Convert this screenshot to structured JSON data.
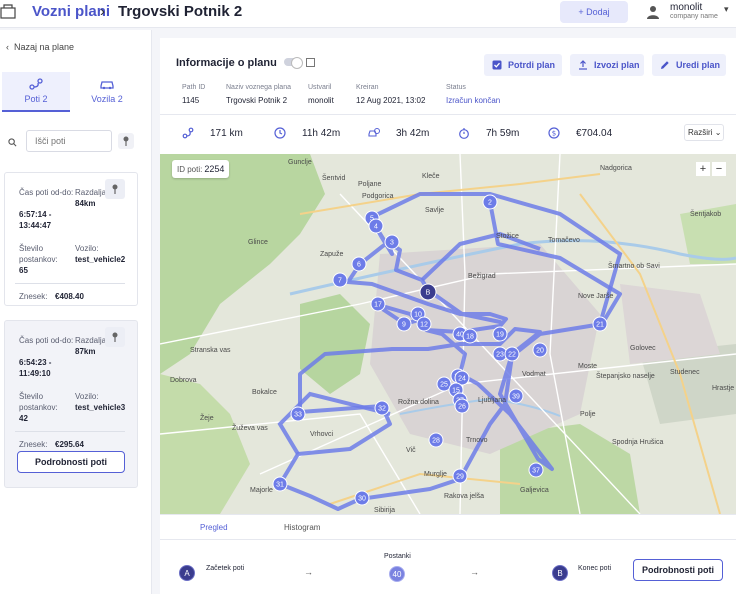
{
  "header": {
    "breadcrumb_root": "Vozni plani",
    "breadcrumb_current": "Trgovski Potnik 2",
    "add_label": "+ Dodaj",
    "user_name": "monolit",
    "company_name": "company name"
  },
  "sidebar": {
    "back_label": "Nazaj na plane",
    "tabs": [
      {
        "label": "Poti 2",
        "icon": "route-icon",
        "active": true
      },
      {
        "label": "Vozila 2",
        "icon": "car-icon",
        "active": false
      }
    ],
    "search_placeholder": "Išči poti",
    "routes": [
      {
        "time_label": "Čas poti od-do:",
        "time_value": "6:57:14 - 13:44:47",
        "distance_label": "Razdalja:",
        "distance_value": "84km",
        "stops_label": "Število postankov:",
        "stops_value": "65",
        "vehicle_label": "Vozilo:",
        "vehicle_value": "test_vehicle2",
        "amount_label": "Znesek:",
        "amount_value": "€408.40"
      },
      {
        "time_label": "Čas poti od-do:",
        "time_value": "6:54:23 - 11:49:10",
        "distance_label": "Razdalja:",
        "distance_value": "87km",
        "stops_label": "Število postankov:",
        "stops_value": "42",
        "vehicle_label": "Vozilo:",
        "vehicle_value": "test_vehicle3",
        "amount_label": "Znesek:",
        "amount_value": "€295.64",
        "details_label": "Podrobnosti poti"
      }
    ]
  },
  "main": {
    "info_title": "Informacije o planu",
    "actions": {
      "confirm": "Potrdi plan",
      "export": "Izvozi plan",
      "edit": "Uredi plan"
    },
    "meta": [
      {
        "label": "Path ID",
        "value": "1145"
      },
      {
        "label": "Naziv voznega plana",
        "value": "Trgovski Potnik 2"
      },
      {
        "label": "Ustvaril",
        "value": "monolit"
      },
      {
        "label": "Kreiran",
        "value": "12 Aug 2021, 13:02"
      },
      {
        "label": "Status",
        "value": "Izračun končan"
      }
    ],
    "stats": {
      "distance": "171 km",
      "total_time": "11h 42m",
      "driving_time": "3h 42m",
      "other_time": "7h 59m",
      "cost": "€704.04",
      "expand_label": "Razširi"
    },
    "map": {
      "id_label": "ID poti:",
      "id_value": "2254",
      "zoom_in": "+",
      "zoom_out": "−",
      "route_color": "#6d7ce8",
      "place_labels": [
        {
          "text": "Gunclje"
        },
        {
          "text": "Kleče"
        },
        {
          "text": "Šentvid"
        },
        {
          "text": "Poljane"
        },
        {
          "text": "Podgorica"
        },
        {
          "text": "Savlje"
        },
        {
          "text": "Stožice"
        },
        {
          "text": "Tomačevo"
        },
        {
          "text": "Nadgorica"
        },
        {
          "text": "Šentjakob"
        },
        {
          "text": "Glince"
        },
        {
          "text": "Zapuže"
        },
        {
          "text": "Šmartno ob Savi"
        },
        {
          "text": "Bežigrad"
        },
        {
          "text": "Nove Jarše"
        },
        {
          "text": "Dobrova"
        },
        {
          "text": "Ljubljana"
        },
        {
          "text": "Moste"
        },
        {
          "text": "Vodmat"
        },
        {
          "text": "Štepanjsko naselje"
        },
        {
          "text": "Studenec"
        },
        {
          "text": "Rožna dolina"
        },
        {
          "text": "Vrhovci"
        },
        {
          "text": "Trnovo"
        },
        {
          "text": "Vič"
        },
        {
          "text": "Murglje"
        },
        {
          "text": "Rakova jelša"
        },
        {
          "text": "Galjevica"
        },
        {
          "text": "Sibirija"
        },
        {
          "text": "Majorle"
        },
        {
          "text": "Bokalce"
        },
        {
          "text": "Žeje"
        },
        {
          "text": "Spodnja Hrušica"
        },
        {
          "text": "Stranska vas"
        },
        {
          "text": "Golovec"
        },
        {
          "text": "Hrastje"
        },
        {
          "text": "Žuževa vas"
        },
        {
          "text": "Polje"
        }
      ],
      "stops": [
        {
          "label": "2"
        },
        {
          "label": "5"
        },
        {
          "label": "4"
        },
        {
          "label": "3"
        },
        {
          "label": "6"
        },
        {
          "label": "7"
        },
        {
          "label": "17"
        },
        {
          "label": "10"
        },
        {
          "label": "9"
        },
        {
          "label": "12"
        },
        {
          "label": "40"
        },
        {
          "label": "18"
        },
        {
          "label": "19"
        },
        {
          "label": "23"
        },
        {
          "label": "22"
        },
        {
          "label": "20"
        },
        {
          "label": "21"
        },
        {
          "label": "14"
        },
        {
          "label": "24"
        },
        {
          "label": "25"
        },
        {
          "label": "15"
        },
        {
          "label": "27"
        },
        {
          "label": "26"
        },
        {
          "label": "39"
        },
        {
          "label": "32"
        },
        {
          "label": "33"
        },
        {
          "label": "28"
        },
        {
          "label": "29"
        },
        {
          "label": "37"
        },
        {
          "label": "30"
        },
        {
          "label": "31"
        },
        {
          "label": "B"
        }
      ]
    },
    "bottom": {
      "tab_overview": "Pregled",
      "tab_histogram": "Histogram",
      "start_marker": "A",
      "start_label": "Začetek poti",
      "stops_title": "Postanki",
      "stops_count": "40",
      "end_marker": "B",
      "end_label": "Konec poti",
      "details_label": "Podrobnosti poti",
      "arrow": "→"
    }
  }
}
